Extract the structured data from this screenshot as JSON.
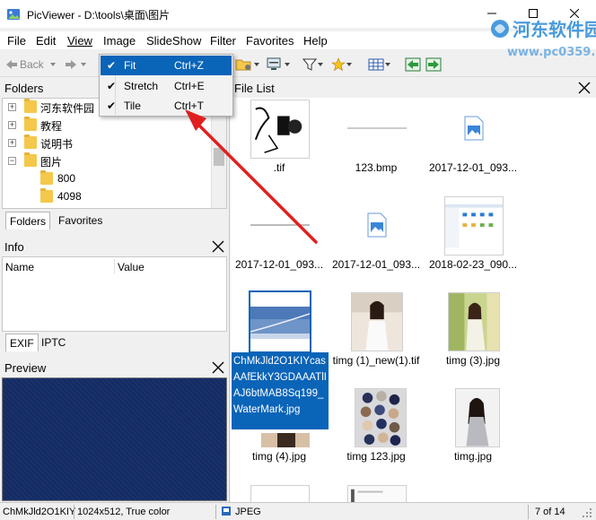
{
  "window": {
    "title": "PicViewer - D:\\tools\\桌面\\图片"
  },
  "watermark": {
    "line1": "河东软件园",
    "line2": "www.pc0359.cn"
  },
  "menu": [
    "File",
    "Edit",
    "View",
    "Image",
    "SlideShow",
    "Filter",
    "Favorites",
    "Help"
  ],
  "toolbar": {
    "back_label": "Back"
  },
  "image_menu": [
    {
      "label": "Fit",
      "shortcut": "Ctrl+Z",
      "checked": true
    },
    {
      "label": "Stretch",
      "shortcut": "Ctrl+E",
      "checked": true
    },
    {
      "label": "Tile",
      "shortcut": "Ctrl+T",
      "checked": true
    }
  ],
  "folders": {
    "title": "Folders",
    "items": [
      {
        "label": "河东软件园",
        "expander": "+"
      },
      {
        "label": "教程",
        "expander": "+"
      },
      {
        "label": "说明书",
        "expander": "+"
      },
      {
        "label": "图片",
        "expander": "−"
      },
      {
        "label": "800",
        "expander": ""
      },
      {
        "label": "4098",
        "expander": ""
      }
    ],
    "tabs": [
      "Folders",
      "Favorites"
    ]
  },
  "info": {
    "title": "Info",
    "columns": [
      "Name",
      "Value"
    ],
    "tabs": [
      "EXIF",
      "IPTC"
    ]
  },
  "preview": {
    "title": "Preview"
  },
  "file_list": {
    "title": "File List",
    "files": [
      {
        "name": ".tif",
        "kind": "sketch"
      },
      {
        "name": "123.bmp",
        "kind": "line"
      },
      {
        "name": "2017-12-01_093...",
        "kind": "icon"
      },
      {
        "name": "2017-12-01_093...",
        "kind": "line"
      },
      {
        "name": "2017-12-01_093...",
        "kind": "icon"
      },
      {
        "name": "2018-02-23_090...",
        "kind": "screen"
      },
      {
        "name": "ChMkJld2O1KIYcasAAfEkkY3GDAAATlIAJ6btMAB8Sq199_WaterMark.jpg",
        "kind": "sky"
      },
      {
        "name": "timg (1)_new(1).tif",
        "kind": "photo"
      },
      {
        "name": "timg (3).jpg",
        "kind": "photo2"
      },
      {
        "name": "timg (4).jpg",
        "kind": "photo3"
      },
      {
        "name": "timg 123.jpg",
        "kind": "dots"
      },
      {
        "name": "timg.jpg",
        "kind": "photo4"
      }
    ]
  },
  "status": {
    "filename": "ChMkJld2O1KIY",
    "dimensions": "1024x512, True color",
    "format": "JPEG",
    "position": "7 of 14"
  },
  "colors": {
    "selection": "#0a64b8",
    "preview_bg": "#132b63",
    "arrow": "#e02020"
  }
}
